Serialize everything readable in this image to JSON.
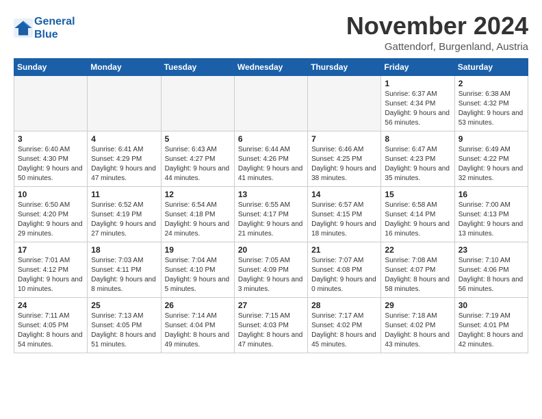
{
  "header": {
    "logo_line1": "General",
    "logo_line2": "Blue",
    "month_title": "November 2024",
    "subtitle": "Gattendorf, Burgenland, Austria"
  },
  "weekdays": [
    "Sunday",
    "Monday",
    "Tuesday",
    "Wednesday",
    "Thursday",
    "Friday",
    "Saturday"
  ],
  "weeks": [
    [
      {
        "day": "",
        "info": ""
      },
      {
        "day": "",
        "info": ""
      },
      {
        "day": "",
        "info": ""
      },
      {
        "day": "",
        "info": ""
      },
      {
        "day": "",
        "info": ""
      },
      {
        "day": "1",
        "info": "Sunrise: 6:37 AM\nSunset: 4:34 PM\nDaylight: 9 hours and 56 minutes."
      },
      {
        "day": "2",
        "info": "Sunrise: 6:38 AM\nSunset: 4:32 PM\nDaylight: 9 hours and 53 minutes."
      }
    ],
    [
      {
        "day": "3",
        "info": "Sunrise: 6:40 AM\nSunset: 4:30 PM\nDaylight: 9 hours and 50 minutes."
      },
      {
        "day": "4",
        "info": "Sunrise: 6:41 AM\nSunset: 4:29 PM\nDaylight: 9 hours and 47 minutes."
      },
      {
        "day": "5",
        "info": "Sunrise: 6:43 AM\nSunset: 4:27 PM\nDaylight: 9 hours and 44 minutes."
      },
      {
        "day": "6",
        "info": "Sunrise: 6:44 AM\nSunset: 4:26 PM\nDaylight: 9 hours and 41 minutes."
      },
      {
        "day": "7",
        "info": "Sunrise: 6:46 AM\nSunset: 4:25 PM\nDaylight: 9 hours and 38 minutes."
      },
      {
        "day": "8",
        "info": "Sunrise: 6:47 AM\nSunset: 4:23 PM\nDaylight: 9 hours and 35 minutes."
      },
      {
        "day": "9",
        "info": "Sunrise: 6:49 AM\nSunset: 4:22 PM\nDaylight: 9 hours and 32 minutes."
      }
    ],
    [
      {
        "day": "10",
        "info": "Sunrise: 6:50 AM\nSunset: 4:20 PM\nDaylight: 9 hours and 29 minutes."
      },
      {
        "day": "11",
        "info": "Sunrise: 6:52 AM\nSunset: 4:19 PM\nDaylight: 9 hours and 27 minutes."
      },
      {
        "day": "12",
        "info": "Sunrise: 6:54 AM\nSunset: 4:18 PM\nDaylight: 9 hours and 24 minutes."
      },
      {
        "day": "13",
        "info": "Sunrise: 6:55 AM\nSunset: 4:17 PM\nDaylight: 9 hours and 21 minutes."
      },
      {
        "day": "14",
        "info": "Sunrise: 6:57 AM\nSunset: 4:15 PM\nDaylight: 9 hours and 18 minutes."
      },
      {
        "day": "15",
        "info": "Sunrise: 6:58 AM\nSunset: 4:14 PM\nDaylight: 9 hours and 16 minutes."
      },
      {
        "day": "16",
        "info": "Sunrise: 7:00 AM\nSunset: 4:13 PM\nDaylight: 9 hours and 13 minutes."
      }
    ],
    [
      {
        "day": "17",
        "info": "Sunrise: 7:01 AM\nSunset: 4:12 PM\nDaylight: 9 hours and 10 minutes."
      },
      {
        "day": "18",
        "info": "Sunrise: 7:03 AM\nSunset: 4:11 PM\nDaylight: 9 hours and 8 minutes."
      },
      {
        "day": "19",
        "info": "Sunrise: 7:04 AM\nSunset: 4:10 PM\nDaylight: 9 hours and 5 minutes."
      },
      {
        "day": "20",
        "info": "Sunrise: 7:05 AM\nSunset: 4:09 PM\nDaylight: 9 hours and 3 minutes."
      },
      {
        "day": "21",
        "info": "Sunrise: 7:07 AM\nSunset: 4:08 PM\nDaylight: 9 hours and 0 minutes."
      },
      {
        "day": "22",
        "info": "Sunrise: 7:08 AM\nSunset: 4:07 PM\nDaylight: 8 hours and 58 minutes."
      },
      {
        "day": "23",
        "info": "Sunrise: 7:10 AM\nSunset: 4:06 PM\nDaylight: 8 hours and 56 minutes."
      }
    ],
    [
      {
        "day": "24",
        "info": "Sunrise: 7:11 AM\nSunset: 4:05 PM\nDaylight: 8 hours and 54 minutes."
      },
      {
        "day": "25",
        "info": "Sunrise: 7:13 AM\nSunset: 4:05 PM\nDaylight: 8 hours and 51 minutes."
      },
      {
        "day": "26",
        "info": "Sunrise: 7:14 AM\nSunset: 4:04 PM\nDaylight: 8 hours and 49 minutes."
      },
      {
        "day": "27",
        "info": "Sunrise: 7:15 AM\nSunset: 4:03 PM\nDaylight: 8 hours and 47 minutes."
      },
      {
        "day": "28",
        "info": "Sunrise: 7:17 AM\nSunset: 4:02 PM\nDaylight: 8 hours and 45 minutes."
      },
      {
        "day": "29",
        "info": "Sunrise: 7:18 AM\nSunset: 4:02 PM\nDaylight: 8 hours and 43 minutes."
      },
      {
        "day": "30",
        "info": "Sunrise: 7:19 AM\nSunset: 4:01 PM\nDaylight: 8 hours and 42 minutes."
      }
    ]
  ]
}
